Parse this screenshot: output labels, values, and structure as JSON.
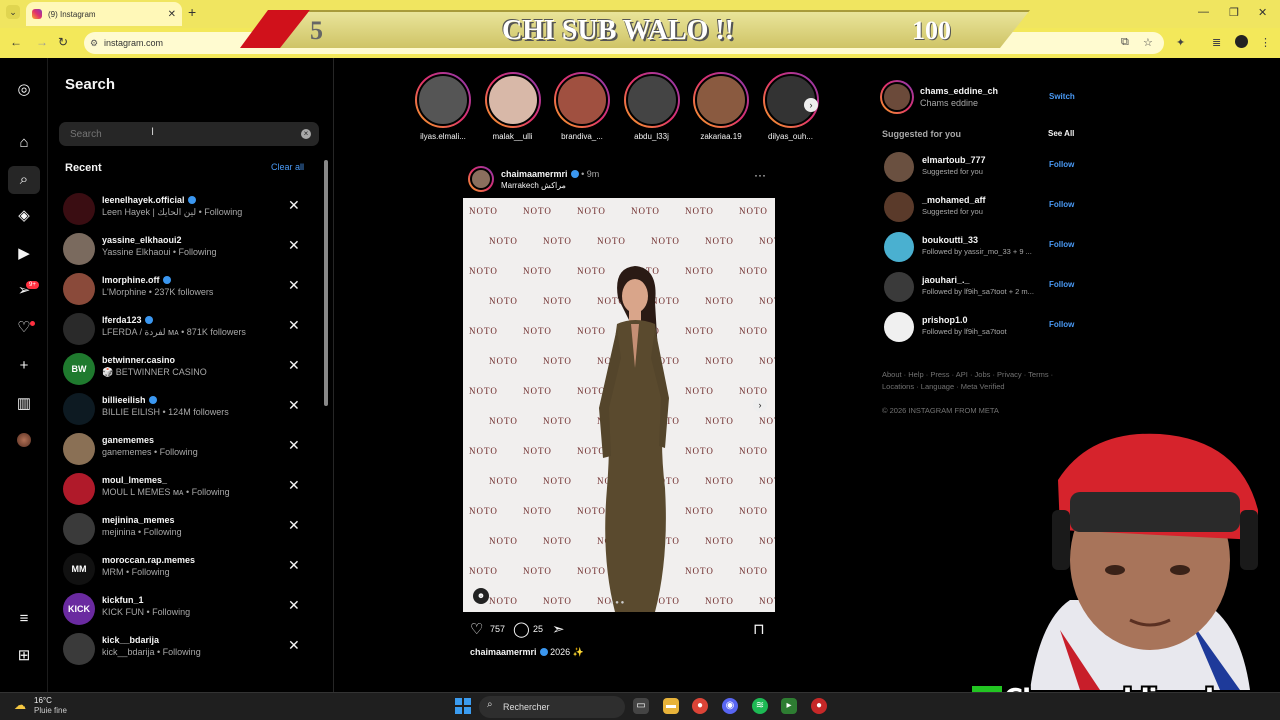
{
  "browser": {
    "tab_title": "(9) Instagram",
    "url": "instagram.com"
  },
  "overlay": {
    "count": "5",
    "text": "CHI SUB WALO !!",
    "goal": "100"
  },
  "nav": {
    "icons": [
      "instagram-icon",
      "home-icon",
      "search-icon",
      "explore-icon",
      "reels-icon",
      "messages-icon",
      "notifications-icon",
      "create-icon",
      "dashboard-icon",
      "profile-icon",
      "menu-icon",
      "meta-icon"
    ],
    "messages_badge": "9+"
  },
  "search": {
    "title": "Search",
    "placeholder": "Search",
    "recent_label": "Recent",
    "clear_all": "Clear all",
    "recent": [
      {
        "name": "leenelhayek.official",
        "sub": "Leen Hayek | لين الحايك • Following",
        "verified": true,
        "color": "#3a0d12"
      },
      {
        "name": "yassine_elkhaoui2",
        "sub": "Yassine Elkhaoui • Following",
        "verified": false,
        "color": "#7a6a5e"
      },
      {
        "name": "lmorphine.off",
        "sub": "L'Morphine • 237K followers",
        "verified": true,
        "color": "#8a4a3a"
      },
      {
        "name": "lferda123",
        "sub": "LFERDA / لفردة ᴍᴀ • 871K followers",
        "verified": true,
        "color": "#2a2a2a"
      },
      {
        "name": "betwinner.casino",
        "sub": "🎲 BETWINNER CASINO",
        "verified": false,
        "color": "#1f7a2e",
        "label": "BW"
      },
      {
        "name": "billieeilish",
        "sub": "BILLIE EILISH • 124M followers",
        "verified": true,
        "color": "#0d1a22"
      },
      {
        "name": "ganememes",
        "sub": "ganememes • Following",
        "verified": false,
        "color": "#8a7055"
      },
      {
        "name": "moul_lmemes_",
        "sub": "MOUL L MEMES ᴍᴀ • Following",
        "verified": false,
        "color": "#b01a2a"
      },
      {
        "name": "mejinina_memes",
        "sub": "mejinina • Following",
        "verified": false,
        "color": "#3a3a3a"
      },
      {
        "name": "moroccan.rap.memes",
        "sub": "MRM • Following",
        "verified": false,
        "color": "#111",
        "label": "MM"
      },
      {
        "name": "kickfun_1",
        "sub": "KICK FUN • Following",
        "verified": false,
        "color": "#6a2aa0",
        "label": "KICK"
      },
      {
        "name": "kick__bdarija",
        "sub": "kick__bdarija • Following",
        "verified": false,
        "color": "#3a3a3a"
      }
    ]
  },
  "stories": [
    {
      "name": "ilyas.elmali...",
      "color": "#555"
    },
    {
      "name": "malak__ulli",
      "color": "#d8b8a8"
    },
    {
      "name": "brandiva_...",
      "color": "#a05040"
    },
    {
      "name": "abdu_l33j",
      "color": "#444"
    },
    {
      "name": "zakariaa.19",
      "color": "#8a5a40"
    },
    {
      "name": "dilyas_ouh...",
      "color": "#333"
    }
  ],
  "post": {
    "username": "chaimaamermri",
    "time": "• 9m",
    "location": "Marrakech مراكش",
    "brand_text": "NOTO",
    "likes": "757",
    "comments": "25",
    "caption_user": "chaimaamermri",
    "caption_text": "2026 ✨"
  },
  "sidebar": {
    "me_username": "chams_eddine_ch",
    "me_name": "Chams eddine",
    "switch": "Switch",
    "suggested_title": "Suggested for you",
    "see_all": "See All",
    "follow_label": "Follow",
    "suggestions": [
      {
        "name": "elmartoub_777",
        "sub": "Suggested for you",
        "color": "#6a5040"
      },
      {
        "name": "_mohamed_aff",
        "sub": "Suggested for you",
        "color": "#5a3a2a"
      },
      {
        "name": "boukoutti_33",
        "sub": "Followed by yassir_mo_33 + 9 ...",
        "color": "#4ab0d0"
      },
      {
        "name": "jaouhari_._",
        "sub": "Followed by lf9ih_sa7toot + 2 m...",
        "color": "#3a3a3a"
      },
      {
        "name": "prishop1.0",
        "sub": "Followed by lf9ih_sa7toot",
        "color": "#f0f0f0"
      }
    ],
    "footer_links": "About · Help · Press · API · Jobs · Privacy · Terms · Locations · Language · Meta Verified",
    "copyright": "© 2026 INSTAGRAM FROM META"
  },
  "webcam": {
    "channel": "Chamseddinech",
    "k": "K"
  },
  "taskbar": {
    "temp": "16°C",
    "weather": "Pluie fine",
    "search": "Rechercher"
  }
}
